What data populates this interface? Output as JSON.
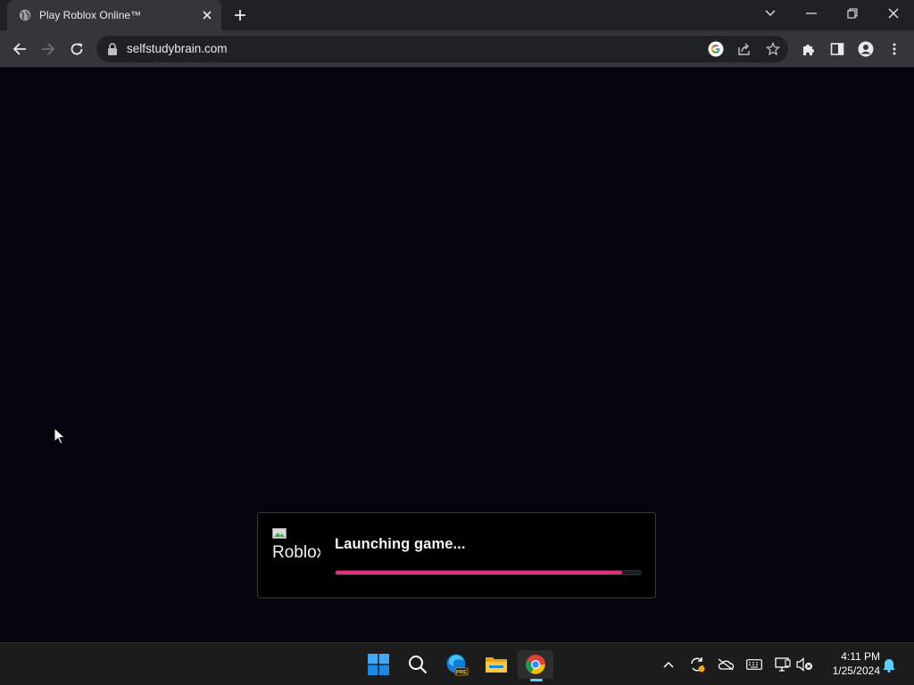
{
  "tab": {
    "title": "Play Roblox Online™",
    "favicon": "globe-icon"
  },
  "toolbar": {
    "url": "selfstudybrain.com"
  },
  "launcher": {
    "image_alt": "Roblox",
    "status_text": "Launching game...",
    "progress_percent": 94,
    "progress_color": "#e0307a"
  },
  "taskbar": {
    "apps": [
      "windows-start-icon",
      "search-icon",
      "edge-preview-icon",
      "file-explorer-icon",
      "chrome-icon"
    ],
    "time": "4:11 PM",
    "date": "1/25/2024"
  },
  "colors": {
    "accent": "#60cdff",
    "page_background": "#05040c"
  }
}
